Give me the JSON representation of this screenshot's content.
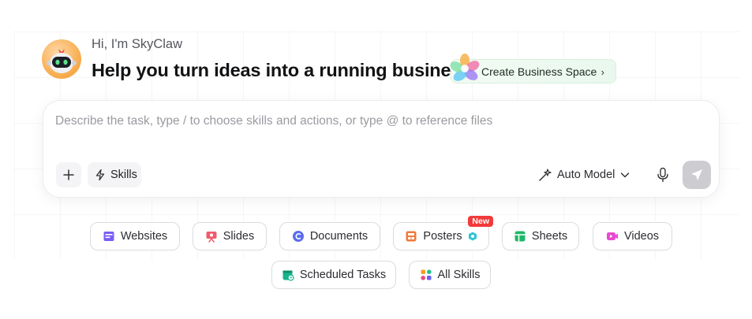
{
  "header": {
    "greeting": "Hi, I'm SkyClaw",
    "headline": "Help you turn ideas into a running business",
    "business_button": "Create Business Space"
  },
  "composer": {
    "placeholder": "Describe the task, type / to choose skills and actions, or type @ to reference files",
    "value": "",
    "skills_label": "Skills",
    "model_label": "Auto Model"
  },
  "chips_row1": [
    {
      "label": "Websites",
      "icon": "websites-icon",
      "color": "#7b5cf5"
    },
    {
      "label": "Slides",
      "icon": "slides-icon",
      "color": "#f25a6e"
    },
    {
      "label": "Documents",
      "icon": "documents-icon",
      "color": "#5b6cf0"
    },
    {
      "label": "Posters",
      "icon": "posters-icon",
      "color": "#f07a3a",
      "badge": "New"
    },
    {
      "label": "Sheets",
      "icon": "sheets-icon",
      "color": "#1fb86a"
    },
    {
      "label": "Videos",
      "icon": "videos-icon",
      "color": "#e94ad2"
    }
  ],
  "chips_row2": [
    {
      "label": "Scheduled Tasks",
      "icon": "scheduled-tasks-icon",
      "color": "#17b38a"
    },
    {
      "label": "All Skills",
      "icon": "all-skills-icon",
      "color": "#f0a020"
    }
  ]
}
